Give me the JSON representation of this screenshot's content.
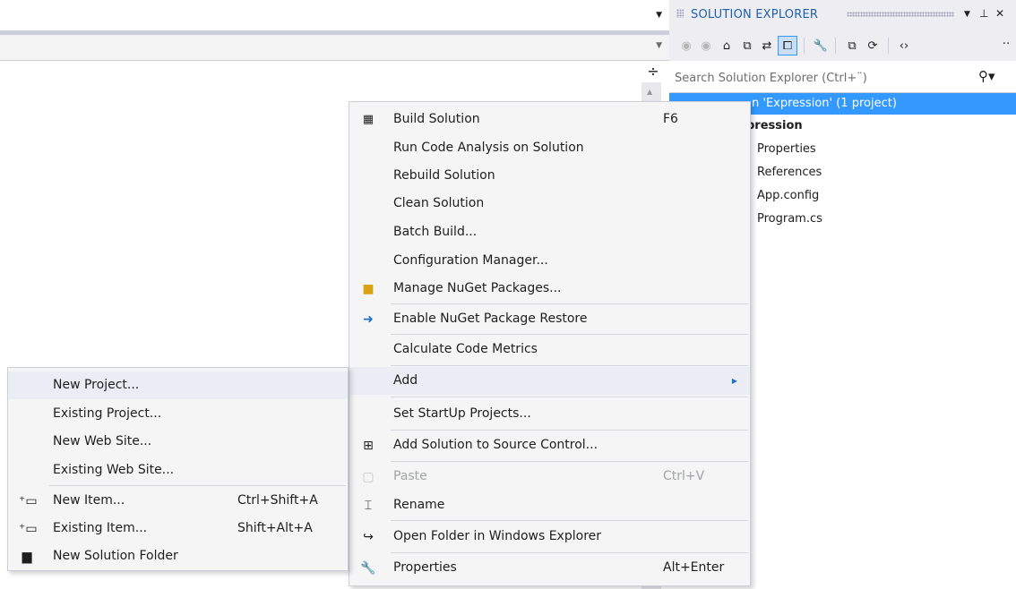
{
  "solution_explorer": {
    "title": "SOLUTION EXPLORER",
    "pin_glyph": "\u0002",
    "search_placeholder": "Search Solution Explorer (Ctrl+¨)",
    "tree": [
      {
        "label": "Solution 'Expression' (1 project)",
        "selected": true
      },
      {
        "label": "Expression",
        "bold": true
      },
      {
        "label": "Properties"
      },
      {
        "label": "References"
      },
      {
        "label": "App.config"
      },
      {
        "label": "Program.cs"
      }
    ],
    "tree_visible": {
      "solution": "n 'Expression' (1 project)",
      "project": "pression",
      "properties": "Properties",
      "references": "References",
      "app_config": "App.config",
      "program_cs": "Program.cs"
    }
  },
  "main_menu": {
    "build_solution": {
      "label": "Build Solution",
      "shortcut": "F6"
    },
    "run_code_analysis": {
      "label": "Run Code Analysis on Solution"
    },
    "rebuild_solution": {
      "label": "Rebuild Solution"
    },
    "clean_solution": {
      "label": "Clean Solution"
    },
    "batch_build": {
      "label": "Batch Build..."
    },
    "configuration_manager": {
      "label": "Configuration Manager..."
    },
    "manage_nuget": {
      "label": "Manage NuGet Packages..."
    },
    "enable_nuget_restore": {
      "label": "Enable NuGet Package Restore"
    },
    "calculate_code_metrics": {
      "label": "Calculate Code Metrics"
    },
    "add": {
      "label": "Add"
    },
    "set_startup_projects": {
      "label": "Set StartUp Projects..."
    },
    "add_to_source_control": {
      "label": "Add Solution to Source Control..."
    },
    "paste": {
      "label": "Paste",
      "shortcut": "Ctrl+V"
    },
    "rename": {
      "label": "Rename"
    },
    "open_folder": {
      "label": "Open Folder in Windows Explorer"
    },
    "properties": {
      "label": "Properties",
      "shortcut": "Alt+Enter"
    }
  },
  "add_submenu": {
    "new_project": {
      "label": "New Project..."
    },
    "existing_project": {
      "label": "Existing Project..."
    },
    "new_web_site": {
      "label": "New Web Site..."
    },
    "existing_web_site": {
      "label": "Existing Web Site..."
    },
    "new_item": {
      "label": "New Item...",
      "shortcut": "Ctrl+Shift+A"
    },
    "existing_item": {
      "label": "Existing Item...",
      "shortcut": "Shift+Alt+A"
    },
    "new_solution_folder": {
      "label": "New Solution Folder"
    }
  },
  "colors": {
    "accent": "#3399ff",
    "selection": "#3399ff",
    "menu_bg": "#f5f5f5",
    "chrome_bg": "#eeeef2"
  }
}
